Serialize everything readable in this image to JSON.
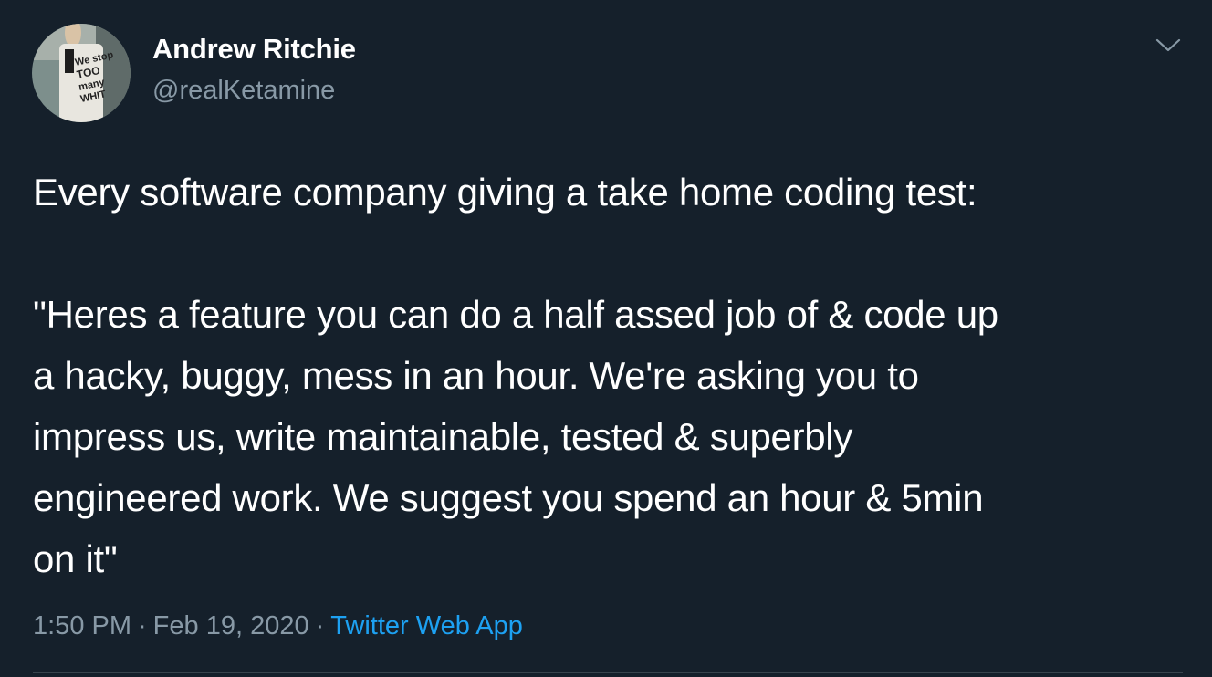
{
  "author": {
    "display_name": "Andrew Ritchie",
    "handle": "@realKetamine",
    "avatar_text": [
      "We stop",
      "TOO",
      "many",
      "WHIT"
    ]
  },
  "menu": {
    "icon": "chevron-down-icon"
  },
  "tweet": {
    "lines": [
      "Every software company giving a take home coding test:",
      "",
      "\"Heres a feature you can do a half assed job of & code up",
      "a hacky, buggy, mess in an hour. We're asking you to",
      "impress us, write maintainable, tested & superbly",
      "engineered work. We suggest you spend an hour & 5min",
      "on it\""
    ]
  },
  "meta": {
    "time": "1:50 PM",
    "separator": "·",
    "date": "Feb 19, 2020",
    "source": "Twitter Web App"
  },
  "colors": {
    "background": "#15202b",
    "text": "#ffffff",
    "secondary": "#8899a6",
    "link": "#1da1f2",
    "divider": "#38444d"
  }
}
